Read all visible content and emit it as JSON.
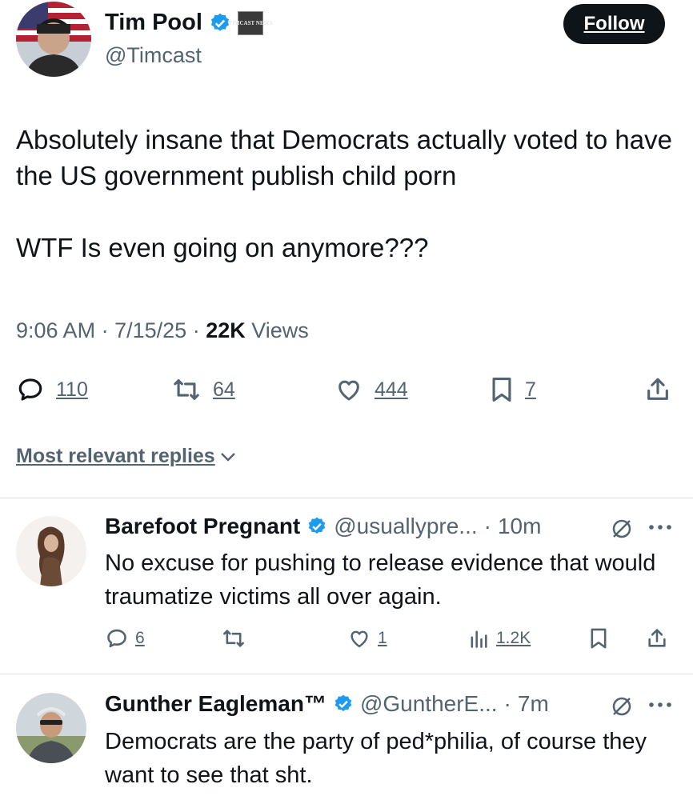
{
  "tweet": {
    "author_name": "Tim Pool",
    "handle": "@Timcast",
    "affiliate_badge_text": "TIMCAST NEWS",
    "follow_label": "Follow",
    "text": "Absolutely insane that Democrats actually voted to have the US government publish child porn\n\nWTF Is even going on anymore???",
    "time": "9:06 AM",
    "date": "7/15/25",
    "views_count": "22K",
    "views_label": "Views",
    "separator": "·",
    "replies_count": "110",
    "reposts_count": "64",
    "likes_count": "444",
    "bookmarks_count": "7"
  },
  "sort": {
    "label": "Most relevant replies"
  },
  "replies": [
    {
      "name": "Barefoot Pregnant",
      "handle": "@usuallypre...",
      "time": "10m",
      "text": "No excuse for pushing to release evidence that would traumatize victims all over again.",
      "reply_count": "6",
      "repost_count": "",
      "like_count": "1",
      "views": "1.2K"
    },
    {
      "name": "Gunther Eagleman™",
      "handle": "@GuntherE...",
      "time": "7m",
      "text": "Democrats are the party of ped*philia, of course they want to see that sht."
    }
  ],
  "colors": {
    "text": "#0f1419",
    "secondary": "#536471",
    "verified_blue": "#1d9bf0",
    "divider": "#dfe3e6"
  },
  "icons": [
    "verified-badge-icon",
    "reply-icon",
    "repost-icon",
    "like-icon",
    "bookmark-icon",
    "share-icon",
    "views-icon",
    "grok-icon",
    "more-icon",
    "chevron-down-icon"
  ]
}
